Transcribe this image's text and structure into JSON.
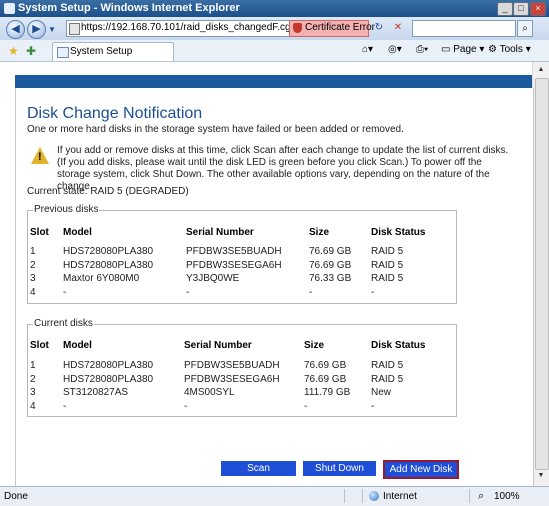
{
  "window": {
    "title": "System Setup - Windows Internet Explorer"
  },
  "address": {
    "url": "https://192.168.70.101/raid_disks_changedF.cgi",
    "cert_error": "Certificate Error"
  },
  "tab": {
    "label": "System Setup"
  },
  "toolbar": {
    "page": "Page",
    "tools": "Tools"
  },
  "page": {
    "heading": "Disk Change Notification",
    "subheading": "One or more hard disks in the storage system have failed or been added or removed.",
    "warning": "If you add or remove disks at this time, click Scan after each change to update the list of current disks. (If you add disks, please wait until the disk LED is green before you click Scan.) To power off the storage system, click Shut Down. The other available options vary, depending on the nature of the change.",
    "current_state": "Current state: RAID 5 (DEGRADED)",
    "columns": [
      "Slot",
      "Model",
      "Serial Number",
      "Size",
      "Disk Status"
    ],
    "previous": {
      "title": "Previous disks",
      "rows": [
        [
          "1",
          "HDS728080PLA380",
          "PFDBW3SE5BUADH",
          "76.69 GB",
          "RAID 5"
        ],
        [
          "2",
          "HDS728080PLA380",
          "PFDBW3SESEGA6H",
          "76.69 GB",
          "RAID 5"
        ],
        [
          "3",
          "Maxtor 6Y080M0",
          "Y3JBQ0WE",
          "76.33 GB",
          "RAID 5"
        ],
        [
          "4",
          "-",
          "-",
          "-",
          "-"
        ]
      ]
    },
    "current": {
      "title": "Current disks",
      "rows": [
        [
          "1",
          "HDS728080PLA380",
          "PFDBW3SE5BUADH",
          "76.69 GB",
          "RAID 5"
        ],
        [
          "2",
          "HDS728080PLA380",
          "PFDBW3SESEGA6H",
          "76.69 GB",
          "RAID 5"
        ],
        [
          "3",
          "ST3120827AS",
          "4MS00SYL",
          "111.79 GB",
          "New"
        ],
        [
          "4",
          "-",
          "-",
          "-",
          "-"
        ]
      ]
    },
    "buttons": {
      "scan": "Scan",
      "shutdown": "Shut Down",
      "add_new_disk": "Add New Disk"
    }
  },
  "statusbar": {
    "status": "Done",
    "zone": "Internet",
    "zoom": "100%"
  }
}
